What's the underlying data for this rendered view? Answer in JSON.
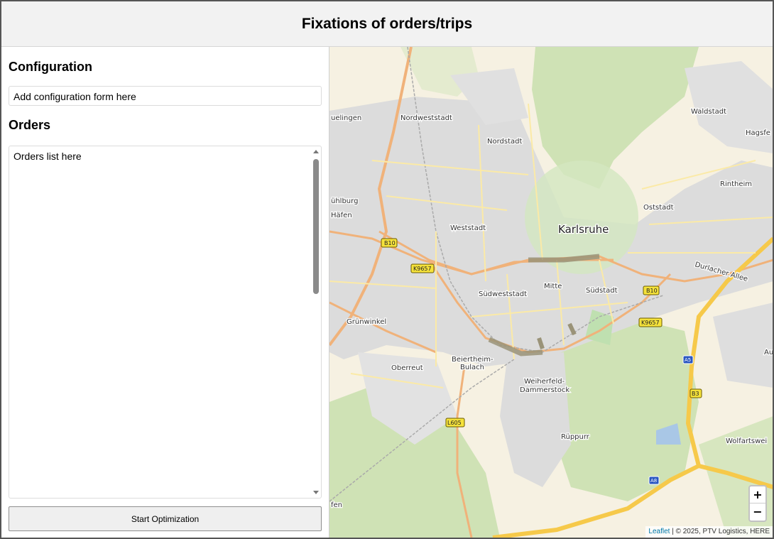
{
  "header": {
    "title": "Fixations of orders/trips"
  },
  "sidebar": {
    "configuration_title": "Configuration",
    "configuration_placeholder": "Add configuration form here",
    "orders_title": "Orders",
    "orders_placeholder": "Orders list here",
    "start_button": "Start Optimization"
  },
  "map": {
    "zoom_in": "+",
    "zoom_out": "−",
    "attribution_link": "Leaflet",
    "attribution_text": " | © 2025, PTV Logistics, HERE",
    "labels": {
      "karlsruhe": "Karlsruhe",
      "nordweststadt": "Nordweststadt",
      "nordstadt": "Nordstadt",
      "waldstadt": "Waldstadt",
      "hagsfeld": "Hagsfe",
      "rintheim": "Rintheim",
      "oststadt": "Oststadt",
      "weststadt": "Weststadt",
      "muehlburg": "ühlburg",
      "hafen": "Häfen",
      "eggenstein": "uelingen",
      "suedweststadt": "Südweststadt",
      "mitte": "Mitte",
      "suedstadt": "Südstadt",
      "durlacher_allee": "Durlacher Allee",
      "gruenwinkel": "Grünwinkel",
      "beiertheim1": "Beiertheim-",
      "beiertheim2": "Bulach",
      "oberreut": "Oberreut",
      "weiherfeld1": "Weiherfeld-",
      "weiherfeld2": "Dammerstock",
      "rueppurr": "Rüppurr",
      "wolfartsweier": "Wolfartswei",
      "aue": "Au",
      "forchheim": "fen"
    },
    "shields": {
      "b10_west": "B10",
      "k9657_west": "K9657",
      "b10_east": "B10",
      "k9657_east": "K9657",
      "a5": "A5",
      "b3": "B3",
      "l605": "L605",
      "a8": "A8"
    },
    "colors": {
      "forest": "#cfe2b5",
      "urban": "#dcdcdc",
      "road_main": "#f0b27a",
      "motorway": "#f6c94a",
      "route": "#9a9378"
    }
  }
}
